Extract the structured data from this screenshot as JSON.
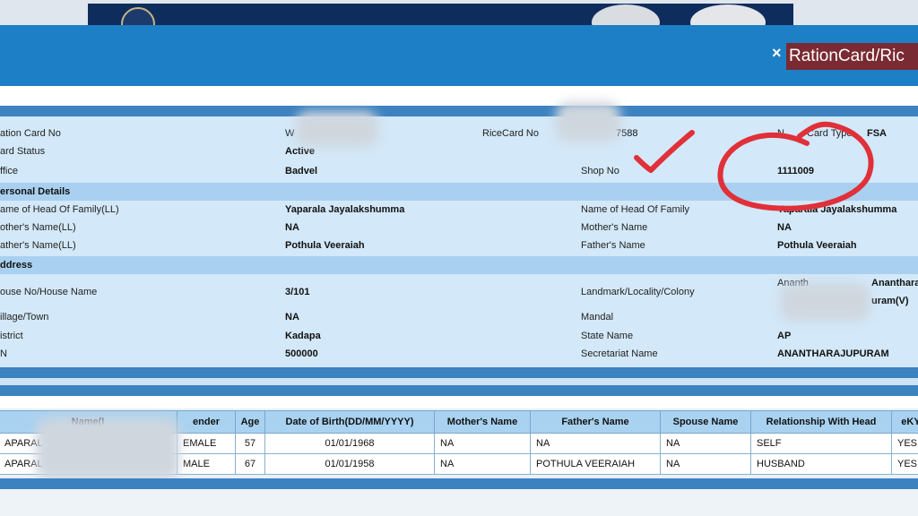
{
  "dialog": {
    "title": "RationCard/Ric",
    "close_icon": "×"
  },
  "details": {
    "ration_card_no_label": "ation Card No",
    "card_no_visible_prefix": "W",
    "rice_card_no_label": "RiceCard No",
    "rice_card_no_value": "7588",
    "card_type_label": "N",
    "card_type_label_tail": "Card Type",
    "card_type_value": "FSA",
    "card_status_label": "ard Status",
    "card_status_value": "Active",
    "office_label": "ffice",
    "office_value": "Badvel",
    "shop_no_label": "Shop No",
    "shop_no_value": "1111009"
  },
  "personal": {
    "section_title": "ersonal Details",
    "head_ll_label": "ame of Head Of Family(LL)",
    "head_ll_value": "Yaparala Jayalakshumma",
    "head_label": "Name of Head Of Family",
    "head_value": "Yaparala Jayalakshumma",
    "mother_ll_label": "other's Name(LL)",
    "mother_ll_value": "NA",
    "mother_label": "Mother's Name",
    "mother_value": "NA",
    "father_ll_label": "ather's Name(LL)",
    "father_ll_value": "Pothula Veeraiah",
    "father_label": "Father's Name",
    "father_value": "Pothula Veeraiah"
  },
  "address": {
    "section_title": "ddress",
    "house_label": "ouse No/House Name",
    "house_value": "3/101",
    "landmark_label": "Landmark/Locality/Colony",
    "landmark_value_line1": "Ananth",
    "landmark_value_line1b": "Anantharа",
    "landmark_value_line2": "uram(V)",
    "village_label": "illage/Town",
    "village_value": "NA",
    "mandal_label": "Mandal",
    "district_label": "istrict",
    "district_value": "Kadapa",
    "state_label": "State Name",
    "state_value": "AP",
    "pin_label": "N",
    "pin_value": "500000",
    "secretariat_label": "Secretariat Name",
    "secretariat_value": "ANANTHARAJUPURAM"
  },
  "members": {
    "headers": [
      "Name(I",
      "ender",
      "Age",
      "Date of Birth(DD/MM/YYYY)",
      "Mother's Name",
      "Father's Name",
      "Spouse Name",
      "Relationship With Head",
      "eKY"
    ],
    "rows": [
      {
        "name": "APARAL",
        "gender": "EMALE",
        "age": "57",
        "dob": "01/01/1968",
        "mother": "NA",
        "father": "NA",
        "spouse": "NA",
        "relation": "SELF",
        "ekyc": "YES"
      },
      {
        "name": "APARAL",
        "gender": "MALE",
        "age": "67",
        "dob": "01/01/1958",
        "mother": "NA",
        "father": "POTHULA VEERAIAH",
        "spouse": "NA",
        "relation": "HUSBAND",
        "ekyc": "YES"
      }
    ]
  },
  "colors": {
    "header": "#1d7fc5",
    "title_bg": "#7a2a32",
    "section_bg": "#a9d0f0",
    "annotation": "#e0303a"
  }
}
